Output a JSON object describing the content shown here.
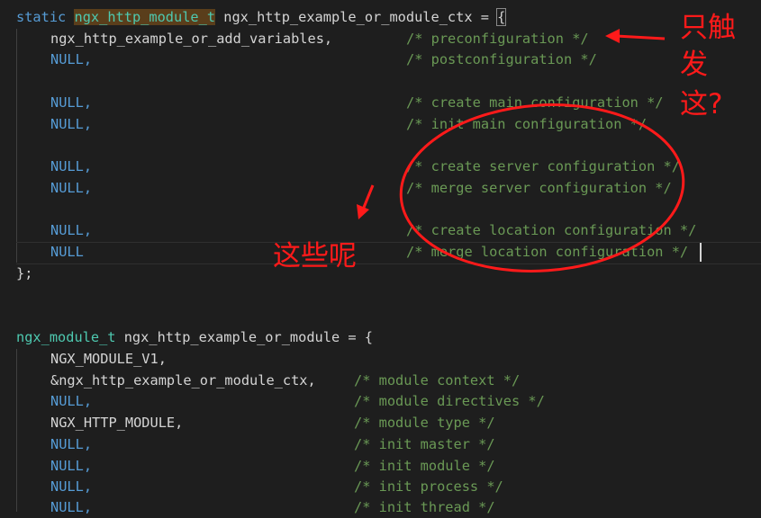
{
  "code": {
    "l1_static": "static",
    "l1_type": "ngx_http_module_t",
    "l1_name": " ngx_http_example_or_module_ctx = ",
    "l1_brace": "{",
    "l2_code": "ngx_http_example_or_add_variables,",
    "l2_cmt": "/* preconfiguration */",
    "l3_code": "NULL,",
    "l3_cmt": "/* postconfiguration */",
    "l4_code": "NULL,",
    "l4_cmt": "/* create main configuration */",
    "l5_code": "NULL,",
    "l5_cmt": "/* init main configuration */",
    "l6_code": "NULL,",
    "l6_cmt": "/* create server configuration */",
    "l7_code": "NULL,",
    "l7_cmt": "/* merge server configuration */",
    "l8_code": "NULL,",
    "l8_cmt": "/* create location configuration */",
    "l9_code": "NULL",
    "l9_cmt": "/* merge location configuration */",
    "l10": "};",
    "m1_type": "ngx_module_t",
    "m1_rest": " ngx_http_example_or_module = {",
    "m2": "NGX_MODULE_V1,",
    "m3_code": "&ngx_http_example_or_module_ctx,",
    "m3_cmt": "/* module context */",
    "m4_code": "NULL,",
    "m4_cmt": "/* module directives */",
    "m5_code": "NGX_HTTP_MODULE,",
    "m5_cmt": "/* module type */",
    "m6_code": "NULL,",
    "m6_cmt": "/* init master */",
    "m7_code": "NULL,",
    "m7_cmt": "/* init module */",
    "m8_code": "NULL,",
    "m8_cmt": "/* init process */",
    "m9_code": "NULL,",
    "m9_cmt": "/* init thread */"
  },
  "annotations": {
    "top_right_line1": "只触",
    "top_right_line2": "发",
    "top_right_line3": "这?",
    "middle": "这些呢"
  },
  "colors": {
    "keyword": "#569cd6",
    "type": "#4ec9b0",
    "comment": "#6a9955",
    "annotation_red": "#ff1a1a"
  }
}
